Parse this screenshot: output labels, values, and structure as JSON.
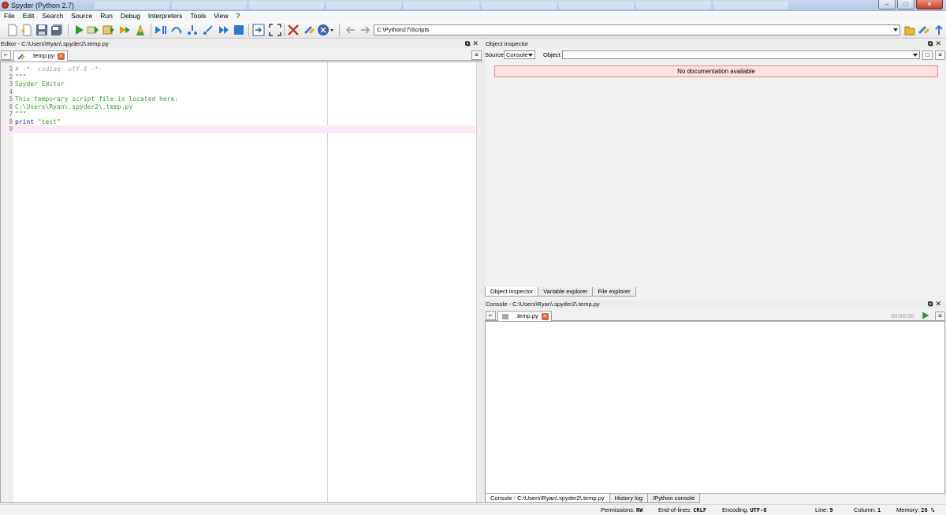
{
  "window": {
    "title": "Spyder (Python 2.7)",
    "minimize": "–",
    "maximize": "□",
    "close": "✕"
  },
  "menubar": [
    "File",
    "Edit",
    "Search",
    "Source",
    "Run",
    "Debug",
    "Interpreters",
    "Tools",
    "View",
    "?"
  ],
  "toolbar": {
    "path": "C:\\Python27\\Scripts",
    "icons": [
      "new-file-icon",
      "open-file-icon",
      "save-icon",
      "save-all-icon",
      "run-icon",
      "run-selection-icon",
      "run-config-icon",
      "debug-icon",
      "profile-icon",
      "debug-start-icon",
      "step-icon",
      "step-into-icon",
      "step-return-icon",
      "continue-icon",
      "stop-icon",
      "maximize-pane-icon",
      "fullscreen-icon",
      "tools-icon",
      "python-path-icon",
      "interpreter-icon",
      "back-arrow-icon",
      "forward-arrow-icon",
      "browse-folder-icon",
      "change-dir-icon",
      "parent-dir-icon"
    ]
  },
  "editor": {
    "header": "Editor - C:\\Users\\Ryan\\.spyder2\\.temp.py",
    "tab": ".temp.py",
    "lines": [
      {
        "n": "1",
        "text": "# -*- coding: utf-8 -*-",
        "kind": "comment"
      },
      {
        "n": "2",
        "text": "\"\"\"",
        "kind": "string"
      },
      {
        "n": "3",
        "text": "Spyder Editor",
        "kind": "string"
      },
      {
        "n": "4",
        "text": "",
        "kind": "string"
      },
      {
        "n": "5",
        "text": "This temporary script file is located here:",
        "kind": "string"
      },
      {
        "n": "6",
        "text": "C:\\Users\\Ryan\\.spyder2\\.temp.py",
        "kind": "string"
      },
      {
        "n": "7",
        "text": "\"\"\"",
        "kind": "string"
      },
      {
        "n": "8",
        "keyword": "print",
        "text": " \"test\"",
        "kind": "mixed"
      },
      {
        "n": "9",
        "text": "",
        "kind": "plain",
        "current": true
      }
    ]
  },
  "inspector": {
    "header": "Object inspector",
    "source_label": "Source",
    "source_value": "Console",
    "object_label": "Object",
    "object_value": "",
    "message": "No documentation available",
    "tabs": [
      "Object inspector",
      "Variable explorer",
      "File explorer"
    ]
  },
  "console": {
    "header": "Console - C:\\Users\\Ryan\\.spyder2\\.temp.py",
    "tab": ".temp.py",
    "timer": "00:00:00",
    "tabs": [
      "Console - C:\\Users\\Ryan\\.spyder2\\.temp.py",
      "History log",
      "IPython console"
    ]
  },
  "status": {
    "permissions_label": "Permissions:",
    "permissions": "RW",
    "eol_label": "End-of-lines:",
    "eol": "CRLF",
    "encoding_label": "Encoding:",
    "encoding": "UTF-8",
    "line_label": "Line:",
    "line": "9",
    "column_label": "Column:",
    "column": "1",
    "memory_label": "Memory:",
    "memory": "26 %"
  },
  "colors": {
    "comment": "#a6a6a6",
    "string": "#33a626",
    "keyword": "#1f2bb0",
    "current_line": "#fde8f7",
    "nodoc_bg": "#fde0e0"
  }
}
